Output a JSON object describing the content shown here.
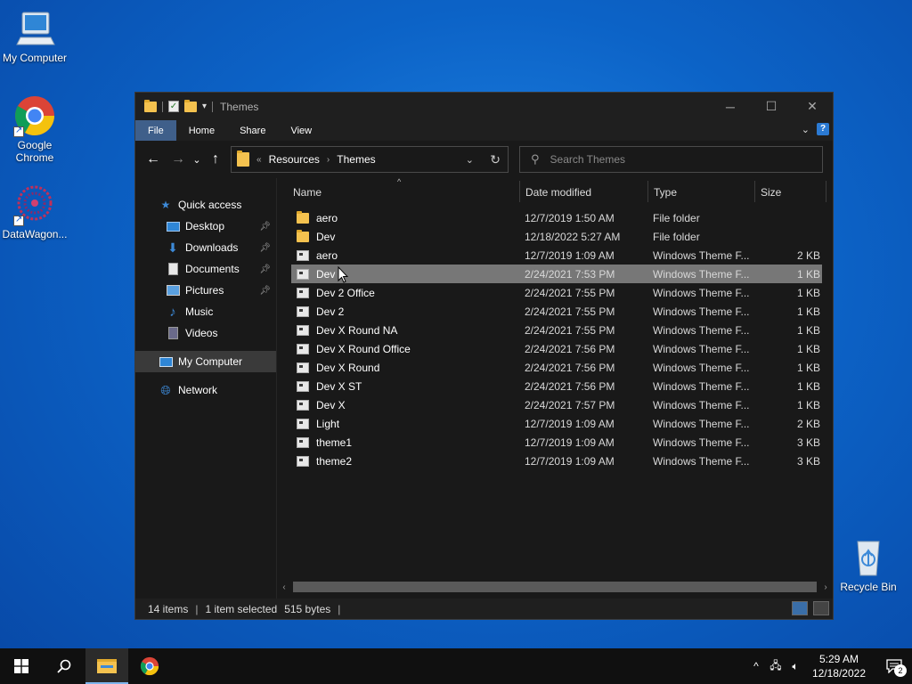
{
  "desktop": {
    "icons": [
      {
        "label": "My Computer",
        "icon": "computer-icon"
      },
      {
        "label": "Google Chrome",
        "icon": "chrome-icon"
      },
      {
        "label": "DataWagon...",
        "icon": "datawagon-icon"
      },
      {
        "label": "Recycle Bin",
        "icon": "recycle-bin-icon"
      }
    ]
  },
  "window": {
    "title": "Themes",
    "ribbon_tabs": [
      "File",
      "Home",
      "Share",
      "View"
    ],
    "address": {
      "crumbs": [
        "Resources",
        "Themes"
      ]
    },
    "search": {
      "placeholder": "Search Themes"
    },
    "nav": {
      "quick_access": "Quick access",
      "items": [
        {
          "label": "Desktop",
          "pinned": true
        },
        {
          "label": "Downloads",
          "pinned": true
        },
        {
          "label": "Documents",
          "pinned": true
        },
        {
          "label": "Pictures",
          "pinned": true
        },
        {
          "label": "Music",
          "pinned": false
        },
        {
          "label": "Videos",
          "pinned": false
        }
      ],
      "my_computer": "My Computer",
      "network": "Network"
    },
    "columns": {
      "name": "Name",
      "date": "Date modified",
      "type": "Type",
      "size": "Size"
    },
    "files": [
      {
        "name": "aero",
        "date": "12/7/2019 1:50 AM",
        "type": "File folder",
        "size": "",
        "kind": "folder"
      },
      {
        "name": "Dev",
        "date": "12/18/2022 5:27 AM",
        "type": "File folder",
        "size": "",
        "kind": "folder"
      },
      {
        "name": "aero",
        "date": "12/7/2019 1:09 AM",
        "type": "Windows Theme F...",
        "size": "2 KB",
        "kind": "theme"
      },
      {
        "name": "Dev 1",
        "date": "2/24/2021 7:53 PM",
        "type": "Windows Theme F...",
        "size": "1 KB",
        "kind": "theme",
        "selected": true
      },
      {
        "name": "Dev 2 Office",
        "date": "2/24/2021 7:55 PM",
        "type": "Windows Theme F...",
        "size": "1 KB",
        "kind": "theme"
      },
      {
        "name": "Dev 2",
        "date": "2/24/2021 7:55 PM",
        "type": "Windows Theme F...",
        "size": "1 KB",
        "kind": "theme"
      },
      {
        "name": "Dev X Round NA",
        "date": "2/24/2021 7:55 PM",
        "type": "Windows Theme F...",
        "size": "1 KB",
        "kind": "theme"
      },
      {
        "name": "Dev X Round Office",
        "date": "2/24/2021 7:56 PM",
        "type": "Windows Theme F...",
        "size": "1 KB",
        "kind": "theme"
      },
      {
        "name": "Dev X Round",
        "date": "2/24/2021 7:56 PM",
        "type": "Windows Theme F...",
        "size": "1 KB",
        "kind": "theme"
      },
      {
        "name": "Dev X ST",
        "date": "2/24/2021 7:56 PM",
        "type": "Windows Theme F...",
        "size": "1 KB",
        "kind": "theme"
      },
      {
        "name": "Dev X",
        "date": "2/24/2021 7:57 PM",
        "type": "Windows Theme F...",
        "size": "1 KB",
        "kind": "theme"
      },
      {
        "name": "Light",
        "date": "12/7/2019 1:09 AM",
        "type": "Windows Theme F...",
        "size": "2 KB",
        "kind": "theme"
      },
      {
        "name": "theme1",
        "date": "12/7/2019 1:09 AM",
        "type": "Windows Theme F...",
        "size": "3 KB",
        "kind": "theme"
      },
      {
        "name": "theme2",
        "date": "12/7/2019 1:09 AM",
        "type": "Windows Theme F...",
        "size": "3 KB",
        "kind": "theme"
      }
    ],
    "status": {
      "count": "14 items",
      "selection": "1 item selected",
      "bytes": "515 bytes"
    }
  },
  "taskbar": {
    "time": "5:29 AM",
    "date": "12/18/2022",
    "notifications": "2"
  }
}
